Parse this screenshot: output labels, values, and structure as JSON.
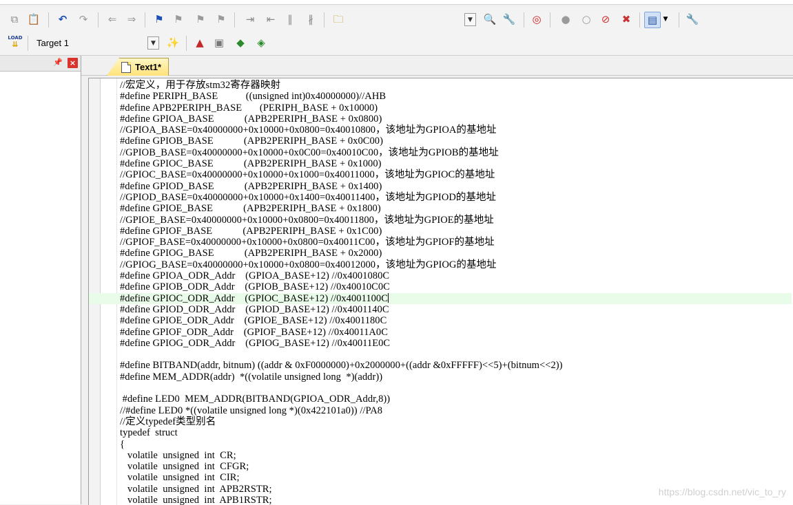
{
  "toolbar2": {
    "target": "Target 1",
    "load_label": "LOAD"
  },
  "tab": {
    "label": "Text1*"
  },
  "editor": {
    "lines": [
      "//宏定义，用于存放stm32寄存器映射",
      "#define PERIPH_BASE           ((unsigned int)0x40000000)//AHB",
      "#define APB2PERIPH_BASE       (PERIPH_BASE + 0x10000)",
      "#define GPIOA_BASE            (APB2PERIPH_BASE + 0x0800)",
      "//GPIOA_BASE=0x40000000+0x10000+0x0800=0x40010800，该地址为GPIOA的基地址",
      "#define GPIOB_BASE            (APB2PERIPH_BASE + 0x0C00)",
      "//GPIOB_BASE=0x40000000+0x10000+0x0C00=0x40010C00，该地址为GPIOB的基地址",
      "#define GPIOC_BASE            (APB2PERIPH_BASE + 0x1000)",
      "//GPIOC_BASE=0x40000000+0x10000+0x1000=0x40011000，该地址为GPIOC的基地址",
      "#define GPIOD_BASE            (APB2PERIPH_BASE + 0x1400)",
      "//GPIOD_BASE=0x40000000+0x10000+0x1400=0x40011400，该地址为GPIOD的基地址",
      "#define GPIOE_BASE            (APB2PERIPH_BASE + 0x1800)",
      "//GPIOE_BASE=0x40000000+0x10000+0x0800=0x40011800，该地址为GPIOE的基地址",
      "#define GPIOF_BASE            (APB2PERIPH_BASE + 0x1C00)",
      "//GPIOF_BASE=0x40000000+0x10000+0x0800=0x40011C00，该地址为GPIOF的基地址",
      "#define GPIOG_BASE            (APB2PERIPH_BASE + 0x2000)",
      "//GPIOG_BASE=0x40000000+0x10000+0x0800=0x40012000，该地址为GPIOG的基地址",
      "#define GPIOA_ODR_Addr    (GPIOA_BASE+12) //0x4001080C",
      "#define GPIOB_ODR_Addr    (GPIOB_BASE+12) //0x40010C0C",
      "#define GPIOC_ODR_Addr    (GPIOC_BASE+12) //0x4001100C",
      "#define GPIOD_ODR_Addr    (GPIOD_BASE+12) //0x4001140C",
      "#define GPIOE_ODR_Addr    (GPIOE_BASE+12) //0x4001180C",
      "#define GPIOF_ODR_Addr    (GPIOF_BASE+12) //0x40011A0C",
      "#define GPIOG_ODR_Addr    (GPIOG_BASE+12) //0x40011E0C",
      "",
      "#define BITBAND(addr, bitnum) ((addr & 0xF0000000)+0x2000000+((addr &0xFFFFF)<<5)+(bitnum<<2))",
      "#define MEM_ADDR(addr)  *((volatile unsigned long  *)(addr))",
      "",
      " #define LED0  MEM_ADDR(BITBAND(GPIOA_ODR_Addr,8))",
      "//#define LED0 *((volatile unsigned long *)(0x422101a0)) //PA8",
      "//定义typedef类型别名",
      "typedef  struct",
      "{",
      "   volatile  unsigned  int  CR;",
      "   volatile  unsigned  int  CFGR;",
      "   volatile  unsigned  int  CIR;",
      "   volatile  unsigned  int  APB2RSTR;",
      "   volatile  unsigned  int  APB1RSTR;"
    ],
    "current_line": 19
  },
  "watermark": "https://blog.csdn.net/vic_to_ry"
}
